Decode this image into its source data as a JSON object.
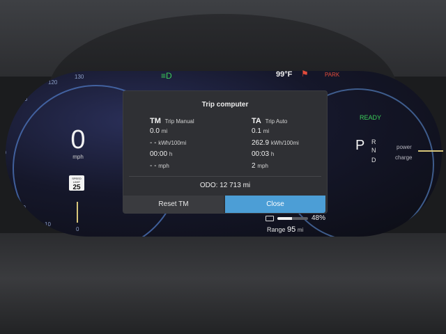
{
  "status": {
    "temperature": "99°F",
    "park": "PARK"
  },
  "speedometer": {
    "ticks": [
      "130",
      "120",
      "100",
      "80",
      "60",
      "40",
      "20",
      "10",
      "0"
    ],
    "value": "0",
    "unit": "mph",
    "speed_limit_label": "SPEED LIMIT",
    "speed_limit_value": "25"
  },
  "trip_computer": {
    "title": "Trip computer",
    "manual": {
      "abbr": "TM",
      "name": "Trip Manual",
      "rows": [
        {
          "value": "0.0",
          "unit": "mi"
        },
        {
          "value": "- -",
          "unit": "kWh/100mi"
        },
        {
          "value": "00:00",
          "unit": "h"
        },
        {
          "value": "- -",
          "unit": "mph"
        }
      ]
    },
    "auto": {
      "abbr": "TA",
      "name": "Trip Auto",
      "rows": [
        {
          "value": "0.1",
          "unit": "mi"
        },
        {
          "value": "262.9",
          "unit": "kWh/100mi"
        },
        {
          "value": "00:03",
          "unit": "h"
        },
        {
          "value": "2",
          "unit": "mph"
        }
      ]
    },
    "odo_label": "ODO:",
    "odo_value": "12 713",
    "odo_unit": "mi",
    "reset_label": "Reset TM",
    "close_label": "Close"
  },
  "drive": {
    "ready": "READY",
    "gear_selected": "P",
    "gears": [
      "R",
      "N",
      "D"
    ],
    "power_label": "power",
    "charge_label": "charge"
  },
  "battery": {
    "level_percent": 48,
    "percent_text": "48%",
    "range_label": "Range",
    "range_value": "95",
    "range_unit": "mi"
  },
  "colors": {
    "ready_green": "#3bd05a",
    "warning_red": "#e34b3b",
    "close_button": "#4c9ed6"
  }
}
